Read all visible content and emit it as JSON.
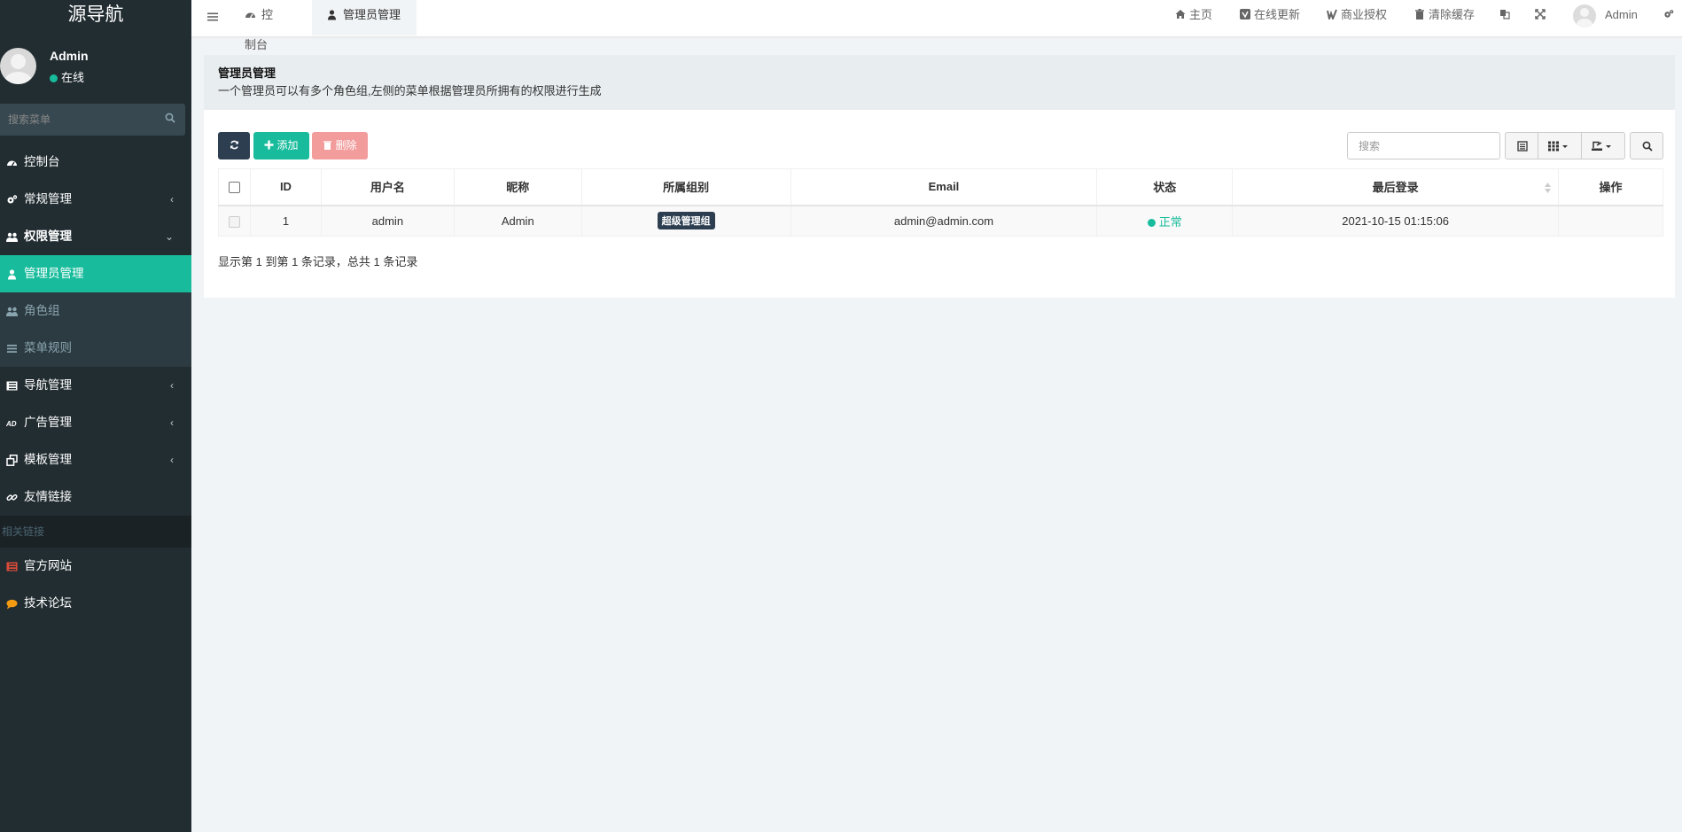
{
  "brand": "源导航",
  "user": {
    "name": "Admin",
    "status": "在线"
  },
  "sidebar": {
    "search_placeholder": "搜索菜单",
    "items": [
      {
        "label": "控制台",
        "icon": "dashboard-icon"
      },
      {
        "label": "常规管理",
        "icon": "cogs-icon",
        "arrow": "‹"
      },
      {
        "label": "权限管理",
        "icon": "group-icon",
        "arrow": "⌄"
      },
      {
        "label": "管理员管理",
        "icon": "user-icon"
      },
      {
        "label": "角色组",
        "icon": "group-icon"
      },
      {
        "label": "菜单规则",
        "icon": "bars-icon"
      },
      {
        "label": "导航管理",
        "icon": "list-icon",
        "arrow": "‹"
      },
      {
        "label": "广告管理",
        "icon": "ad-icon",
        "arrow": "‹"
      },
      {
        "label": "模板管理",
        "icon": "clone-icon",
        "arrow": "‹"
      },
      {
        "label": "友情链接",
        "icon": "link-icon"
      }
    ],
    "header": "相关链接",
    "links": [
      {
        "label": "官方网站",
        "icon": "list-icon",
        "color": "#dd4b39"
      },
      {
        "label": "技术论坛",
        "icon": "comment-icon",
        "color": "#f39c12"
      }
    ]
  },
  "topbar": {
    "tabs": [
      {
        "label": "控制台",
        "icon": "dashboard-icon"
      },
      {
        "label": "管理员管理",
        "icon": "user-icon"
      }
    ],
    "links": {
      "home": "主页",
      "update": "在线更新",
      "license": "商业授权",
      "clear_cache": "清除缓存",
      "user": "Admin"
    }
  },
  "content": {
    "title": "管理员管理",
    "description": "一个管理员可以有多个角色组,左侧的菜单根据管理员所拥有的权限进行生成"
  },
  "toolbar": {
    "add_label": "添加",
    "delete_label": "删除",
    "search_placeholder": "搜索"
  },
  "table": {
    "columns": [
      "ID",
      "用户名",
      "昵称",
      "所属组别",
      "Email",
      "状态",
      "最后登录",
      "操作"
    ],
    "rows": [
      {
        "id": "1",
        "username": "admin",
        "nickname": "Admin",
        "group": "超级管理组",
        "email": "admin@admin.com",
        "status": "正常",
        "last_login": "2021-10-15 01:15:06",
        "actions": ""
      }
    ]
  },
  "pagination": {
    "info": "显示第 1 到第 1 条记录，总共 1 条记录"
  },
  "colors": {
    "accent": "#18bc9c",
    "sidebar": "#222d32",
    "danger": "#f39c9c",
    "dark": "#2c3e50"
  }
}
